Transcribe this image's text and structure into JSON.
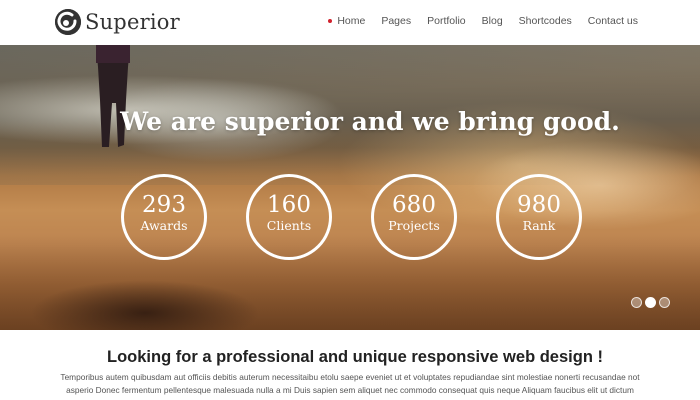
{
  "brand": {
    "name": "Superior",
    "logo_icon": "circle-check-logo-icon"
  },
  "nav": {
    "items": [
      {
        "label": "Home",
        "active": true
      },
      {
        "label": "Pages",
        "active": false
      },
      {
        "label": "Portfolio",
        "active": false
      },
      {
        "label": "Blog",
        "active": false
      },
      {
        "label": "Shortcodes",
        "active": false
      },
      {
        "label": "Contact us",
        "active": false
      }
    ],
    "active_color": "#d1222d"
  },
  "hero": {
    "title": "We are superior and we bring good.",
    "stats": [
      {
        "value": "293",
        "label": "Awards"
      },
      {
        "value": "160",
        "label": "Clients"
      },
      {
        "value": "680",
        "label": "Projects"
      },
      {
        "value": "980",
        "label": "Rank"
      }
    ],
    "slider": {
      "count": 3,
      "active_index": 1
    }
  },
  "content": {
    "heading": "Looking for a professional and unique responsive web design !",
    "body": "Temporibus autem quibusdam aut officiis debitis auterum necessitaibu etolu saepe eveniet ut et voluptates repudiandae sint molestiae nonerti recusandae not asperio Donec fermentum pellentesque malesuada nulla a mi Duis sapien sem aliquet nec commodo consequat quis neque Aliquam faucibus elit ut dictum aliquet"
  }
}
